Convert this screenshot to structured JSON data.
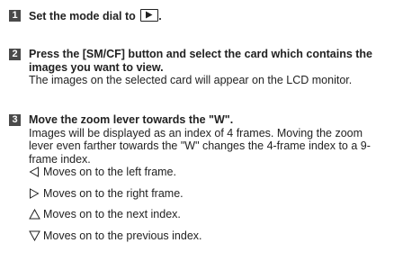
{
  "steps": [
    {
      "number": "1",
      "title_prefix": "Set the mode dial to",
      "title_suffix": ".",
      "icon": "playback-mode-icon"
    },
    {
      "number": "2",
      "title": "Press the [SM/CF] button and select the card which contains the images you want to view.",
      "body": "The images on the selected card will appear on the LCD monitor."
    },
    {
      "number": "3",
      "title": "Move the zoom lever towards the \"W\".",
      "body": "Images will be displayed as an index of 4 frames. Moving the zoom lever even farther towards the \"W\" changes the 4-frame index to a 9-frame index.",
      "nav": [
        {
          "icon": "left-triangle-icon",
          "text": "Moves on to the left frame."
        },
        {
          "icon": "right-triangle-icon",
          "text": "Moves on to the right frame."
        },
        {
          "icon": "up-triangle-icon",
          "text": "Moves on to the next index."
        },
        {
          "icon": "down-triangle-icon",
          "text": "Moves on to the previous index."
        }
      ]
    }
  ]
}
